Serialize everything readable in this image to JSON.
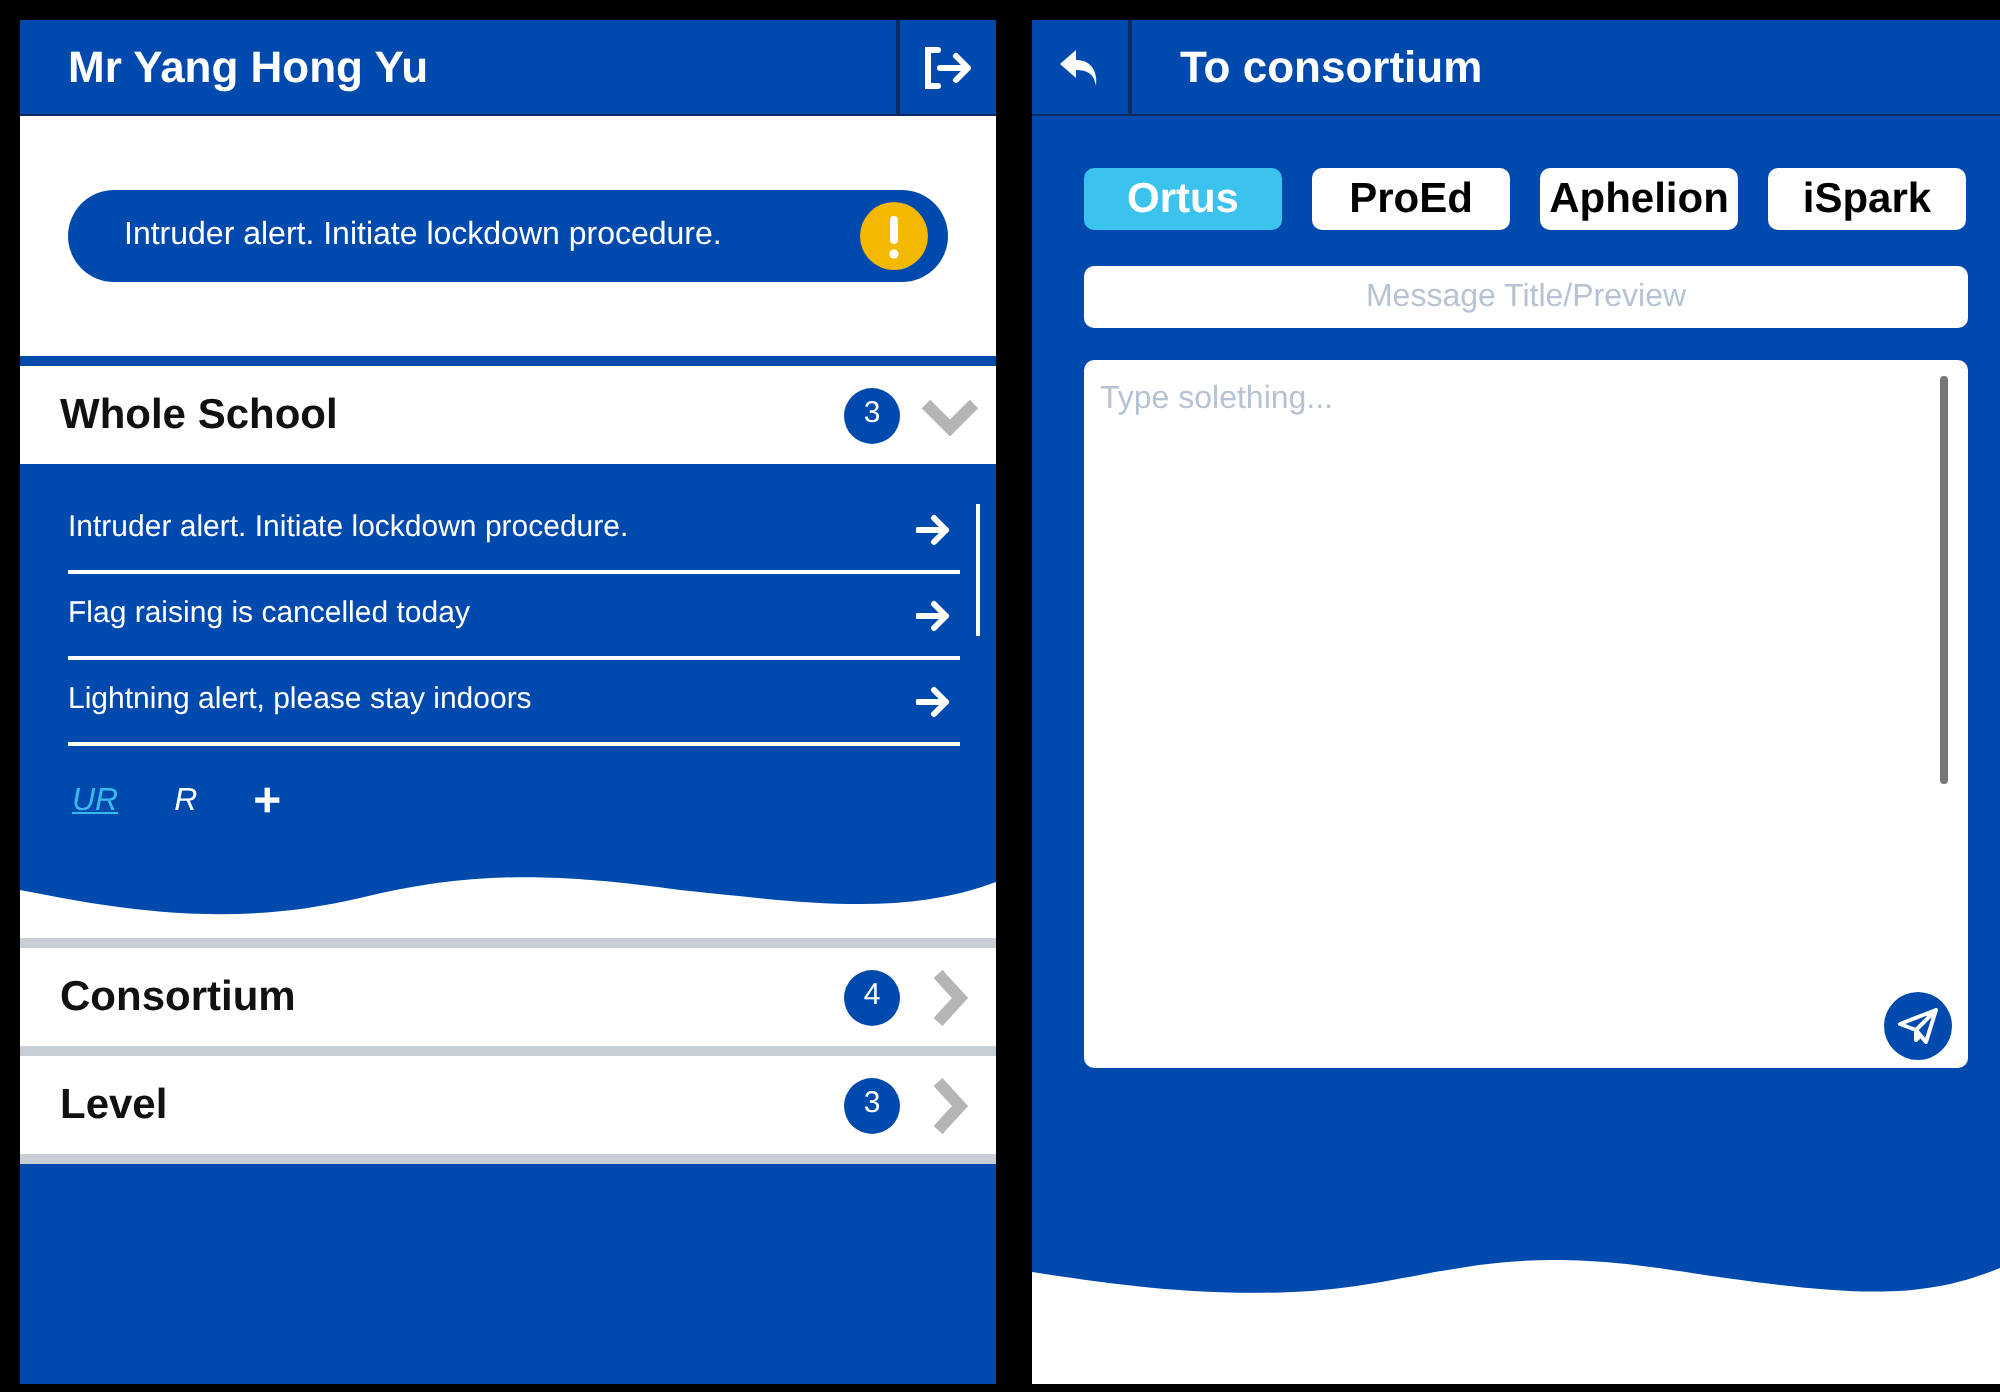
{
  "user_screen": {
    "title": "Mr Yang Hong Yu",
    "alert": {
      "text": "Intruder alert. Initiate lockdown procedure."
    },
    "groups": [
      {
        "name": "Whole School",
        "count": "3",
        "expanded": true,
        "messages": [
          "Intruder alert. Initiate lockdown procedure.",
          "Flag raising is cancelled today",
          "Lightning alert, please stay indoors"
        ],
        "filters": [
          {
            "label": "UR",
            "selected": true
          },
          {
            "label": "R",
            "selected": false
          }
        ],
        "add": "+"
      },
      {
        "name": "Consortium",
        "count": "4",
        "expanded": false
      },
      {
        "name": "Level",
        "count": "3",
        "expanded": false
      }
    ]
  },
  "compose_screen": {
    "title": "To consortium",
    "recipients": [
      {
        "label": "Ortus",
        "selected": true
      },
      {
        "label": "ProEd",
        "selected": false
      },
      {
        "label": "Aphelion",
        "selected": false
      },
      {
        "label": "iSpark",
        "selected": false
      }
    ],
    "title_field": {
      "placeholder": "Message Title/Preview"
    },
    "body_field": {
      "placeholder": "Type solething..."
    }
  }
}
